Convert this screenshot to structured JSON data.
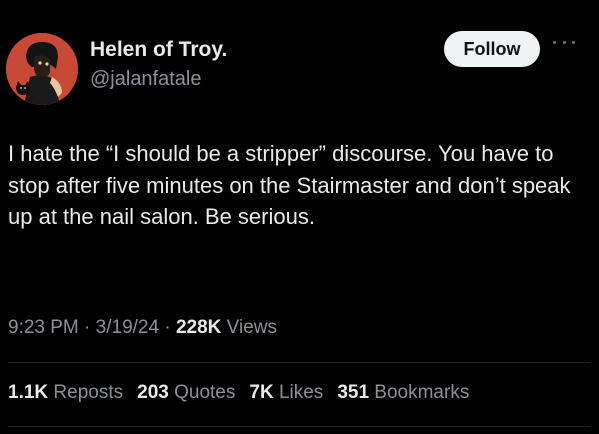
{
  "user": {
    "display_name": "Helen of Troy.",
    "handle": "@jalanfatale",
    "avatar_bg": "#c84a36"
  },
  "actions": {
    "follow_label": "Follow",
    "more_icon": "more-horizontal-icon"
  },
  "tweet": {
    "text": "I hate the “I should be a stripper” discourse. You have to stop after five minutes on the Stairmaster and don’t speak up at the nail salon. Be serious."
  },
  "meta": {
    "time": "9:23 PM",
    "sep1": " · ",
    "date": "3/19/24",
    "sep2": " · ",
    "views_count": "228K",
    "views_label": " Views"
  },
  "stats": [
    {
      "count": "1.1K",
      "label": "Reposts"
    },
    {
      "count": "203",
      "label": "Quotes"
    },
    {
      "count": "7K",
      "label": "Likes"
    },
    {
      "count": "351",
      "label": "Bookmarks"
    }
  ],
  "colors": {
    "background": "#000000",
    "text_primary": "#e7e9ea",
    "text_secondary": "#8b9197",
    "follow_bg": "#eff3f4"
  }
}
